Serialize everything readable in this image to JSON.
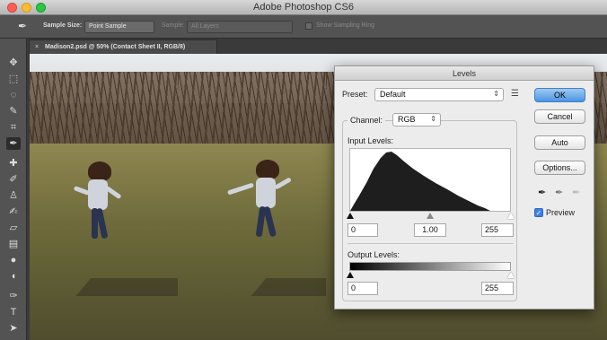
{
  "app": {
    "title": "Adobe Photoshop CS6"
  },
  "options_bar": {
    "sample_size_label": "Sample Size:",
    "sample_size_value": "Point Sample",
    "sample_label": "Sample:",
    "sample_value": "All Layers",
    "show_sampling_ring": "Show Sampling Ring"
  },
  "document_tab": {
    "close": "×",
    "title": "Madison2.psd @ 50% (Contact Sheet II, RGB/8)"
  },
  "levels": {
    "title": "Levels",
    "preset_label": "Preset:",
    "preset_value": "Default",
    "channel_label": "Channel:",
    "channel_value": "RGB",
    "input_levels_label": "Input Levels:",
    "input_black": "0",
    "input_gamma": "1.00",
    "input_white": "255",
    "output_levels_label": "Output Levels:",
    "output_black": "0",
    "output_white": "255",
    "buttons": {
      "ok": "OK",
      "cancel": "Cancel",
      "auto": "Auto",
      "options": "Options..."
    },
    "preview_label": "Preview",
    "preview_checked": true
  }
}
